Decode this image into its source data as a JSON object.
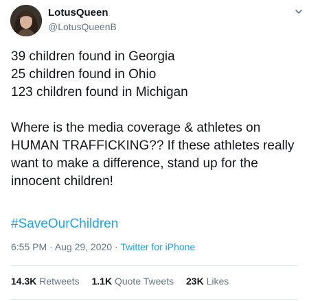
{
  "user": {
    "display_name": "LotusQueen",
    "handle": "@LotusQueenB"
  },
  "tweet": {
    "paragraphs": [
      [
        "39 children found in Georgia",
        "25 children found in Ohio",
        "123 children found in Michigan"
      ],
      [
        "Where is the media coverage & athletes on",
        "HUMAN TRAFFICKING?? If these athletes really",
        "want to make a difference, stand up for the",
        "innocent children!"
      ]
    ],
    "hashtag": "#SaveOurChildren",
    "time": "6:55 PM",
    "date": "Aug 29, 2020",
    "separator": " · ",
    "source": "Twitter for iPhone"
  },
  "stats": {
    "retweets": {
      "count": "14.3K",
      "label": "Retweets"
    },
    "quotes": {
      "count": "1.1K",
      "label": "Quote Tweets"
    },
    "likes": {
      "count": "23K",
      "label": "Likes"
    }
  },
  "icons": {
    "menu": "chevron-down-icon"
  },
  "colors": {
    "text": "#14171a",
    "muted": "#657786",
    "link": "#1da1f2",
    "divider": "#e1e8ed"
  }
}
